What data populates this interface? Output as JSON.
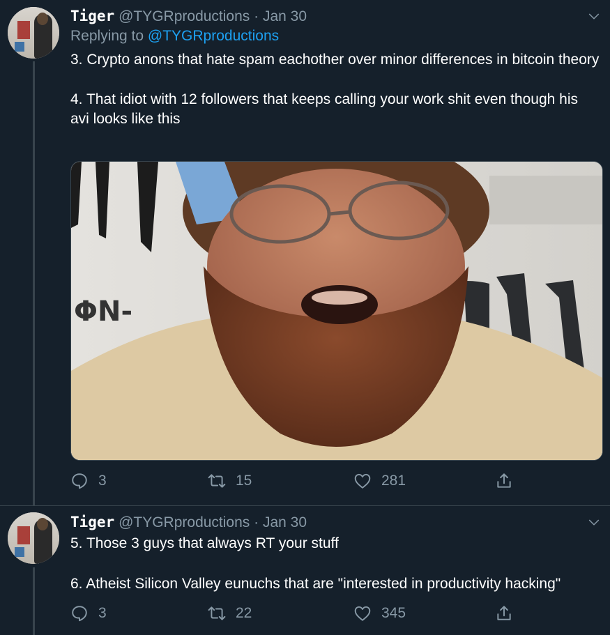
{
  "tweets": [
    {
      "name": "Tiger",
      "handle": "@TYGRproductions",
      "date": "· Jan 30",
      "replying_label": "Replying to",
      "replying_to": "@TYGRproductions",
      "text1": "3. Crypto anons that hate spam eachother over minor differences in bitcoin theory",
      "text2": "4. That idiot with 12 followers that keeps calling your work shit even though his avi looks like this",
      "media_text": "ΦN-",
      "replies": "3",
      "retweets": "15",
      "likes": "281"
    },
    {
      "name": "Tiger",
      "handle": "@TYGRproductions",
      "date": "· Jan 30",
      "text1": "5. Those 3 guys that always RT your stuff",
      "text2": "6. Atheist Silicon Valley eunuchs that are \"interested in productivity hacking\"",
      "replies": "3",
      "retweets": "22",
      "likes": "345"
    }
  ],
  "colors": {
    "background": "#15202b",
    "text": "#ffffff",
    "muted": "#8899a6",
    "link": "#1da1f2",
    "divider": "#38444d"
  },
  "icons": [
    "chevron-down-icon",
    "reply-icon",
    "retweet-icon",
    "like-icon",
    "share-icon"
  ]
}
